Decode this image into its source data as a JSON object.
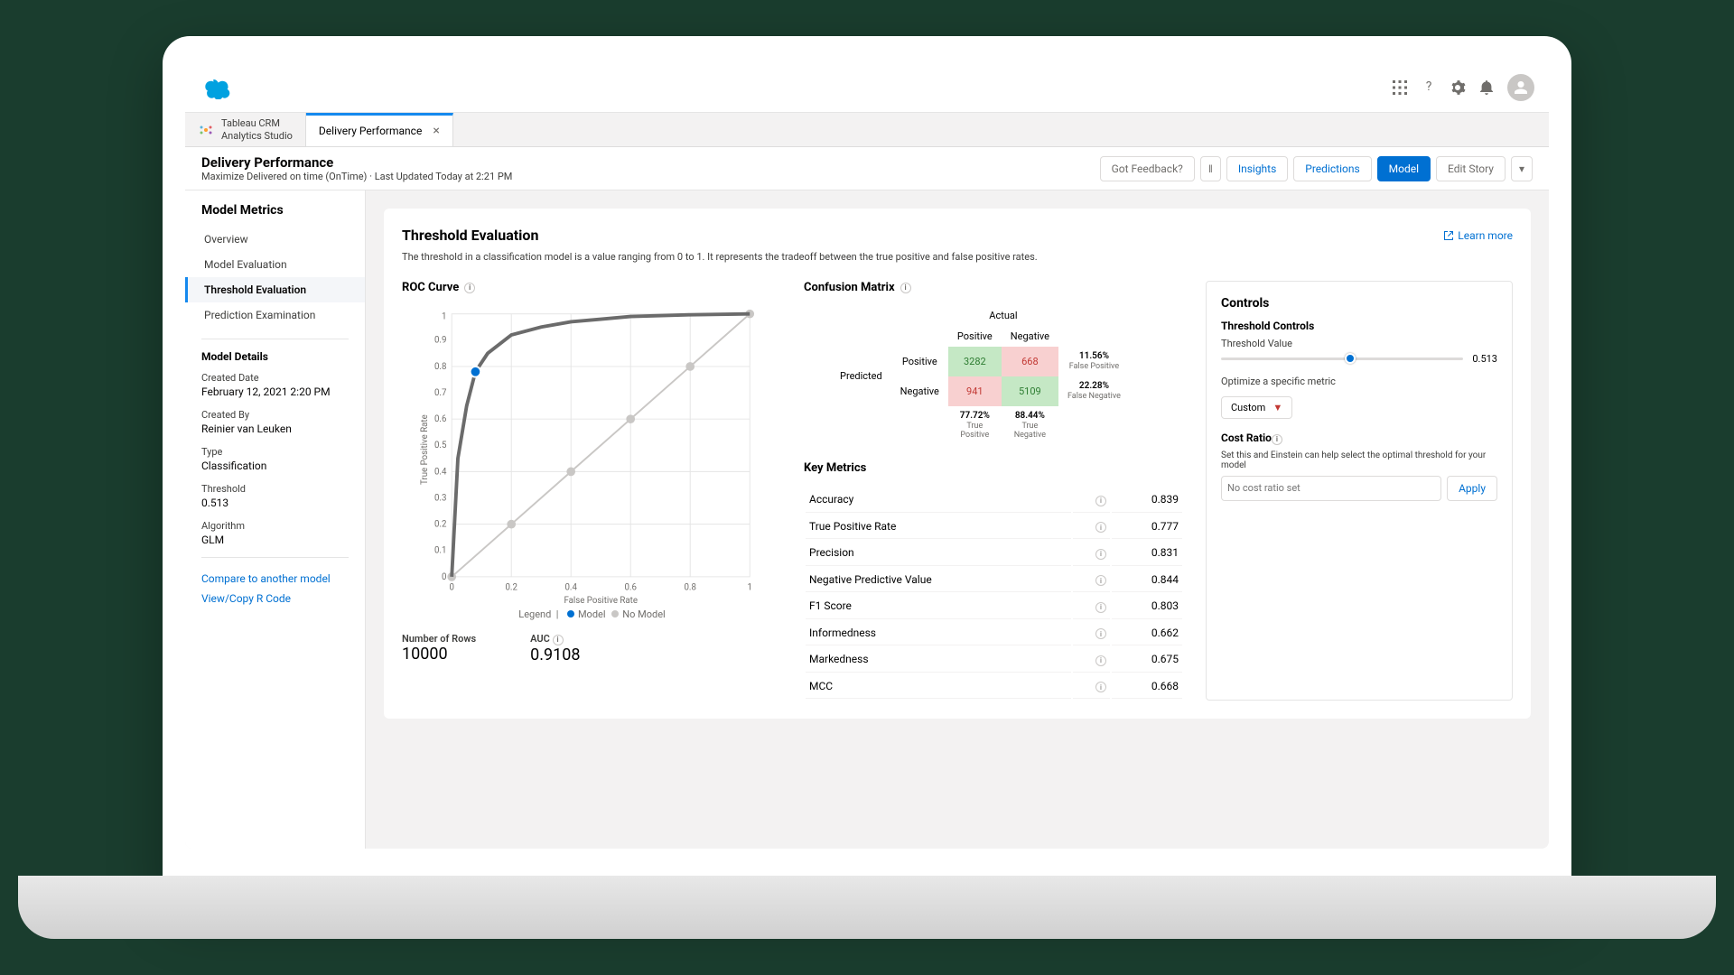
{
  "topbar": {
    "app_waffle": "app-launcher",
    "help": "?",
    "app_product": "Tableau CRM",
    "app_subproduct": "Analytics Studio",
    "page_tab": "Delivery Performance"
  },
  "header": {
    "title": "Delivery Performance",
    "subtitle": "Maximize Delivered on time (OnTime) · Last Updated Today at 2:21 PM",
    "actions": {
      "feedback": "Got Feedback?",
      "insights": "Insights",
      "predictions": "Predictions",
      "model": "Model",
      "edit_story": "Edit Story"
    }
  },
  "sidebar": {
    "title": "Model Metrics",
    "items": [
      {
        "label": "Overview"
      },
      {
        "label": "Model Evaluation"
      },
      {
        "label": "Threshold Evaluation"
      },
      {
        "label": "Prediction Examination"
      }
    ],
    "details_title": "Model Details",
    "meta": {
      "created_date_lbl": "Created Date",
      "created_date": "February 12, 2021 2:20 PM",
      "created_by_lbl": "Created By",
      "created_by": "Reinier van Leuken",
      "type_lbl": "Type",
      "type": "Classification",
      "threshold_lbl": "Threshold",
      "threshold": "0.513",
      "algorithm_lbl": "Algorithm",
      "algorithm": "GLM"
    },
    "links": {
      "compare": "Compare to another model",
      "rcode": "View/Copy R Code"
    }
  },
  "main": {
    "title": "Threshold Evaluation",
    "learn_more": "Learn more",
    "desc": "The threshold in a classification model is a value ranging from 0 to 1. It represents the tradeoff between the true positive and false positive rates."
  },
  "roc": {
    "title": "ROC Curve",
    "ylabel": "True Positive Rate",
    "xlabel": "False Positive Rate",
    "legend_label": "Legend",
    "legend_model": "Model",
    "legend_nomodel": "No Model",
    "rows_lbl": "Number of Rows",
    "rows": "10000",
    "auc_lbl": "AUC",
    "auc": "0.9108"
  },
  "confusion": {
    "title": "Confusion Matrix",
    "actual": "Actual",
    "predicted": "Predicted",
    "positive": "Positive",
    "negative": "Negative",
    "tp": "3282",
    "fp": "668",
    "fn": "941",
    "tn": "5109",
    "fp_rate": "11.56%",
    "fp_sub": "False Positive",
    "fn_rate": "22.28%",
    "fn_sub": "False Negative",
    "tp_rate": "77.72%",
    "tp_sub": "True Positive",
    "tn_rate": "88.44%",
    "tn_sub": "True Negative"
  },
  "metrics": {
    "title": "Key Metrics",
    "rows": [
      {
        "name": "Accuracy",
        "value": "0.839"
      },
      {
        "name": "True Positive Rate",
        "value": "0.777"
      },
      {
        "name": "Precision",
        "value": "0.831"
      },
      {
        "name": "Negative Predictive Value",
        "value": "0.844"
      },
      {
        "name": "F1 Score",
        "value": "0.803"
      },
      {
        "name": "Informedness",
        "value": "0.662"
      },
      {
        "name": "Markedness",
        "value": "0.675"
      },
      {
        "name": "MCC",
        "value": "0.668"
      }
    ]
  },
  "controls": {
    "title": "Controls",
    "threshold_controls": "Threshold Controls",
    "threshold_value_lbl": "Threshold Value",
    "threshold_value": "0.513",
    "optimize_lbl": "Optimize a specific metric",
    "optimize_value": "Custom",
    "cost_ratio_lbl": "Cost Ratio",
    "cost_ratio_help": "Set this and Einstein can help select the optimal threshold for your model",
    "cost_placeholder": "No cost ratio set",
    "apply": "Apply"
  },
  "chart_data": {
    "type": "line",
    "title": "ROC Curve",
    "xlabel": "False Positive Rate",
    "ylabel": "True Positive Rate",
    "xlim": [
      0,
      1
    ],
    "ylim": [
      0,
      1
    ],
    "series": [
      {
        "name": "Model",
        "x": [
          0,
          0.02,
          0.05,
          0.08,
          0.12,
          0.2,
          0.3,
          0.4,
          0.5,
          0.6,
          0.7,
          0.8,
          0.9,
          1.0
        ],
        "y": [
          0,
          0.45,
          0.65,
          0.78,
          0.85,
          0.92,
          0.95,
          0.97,
          0.98,
          0.99,
          0.995,
          0.998,
          0.999,
          1.0
        ]
      },
      {
        "name": "No Model",
        "x": [
          0,
          0.2,
          0.4,
          0.6,
          0.8,
          1.0
        ],
        "y": [
          0,
          0.2,
          0.4,
          0.6,
          0.8,
          1.0
        ]
      }
    ],
    "threshold_point": {
      "fpr": 0.08,
      "tpr": 0.78
    },
    "auc": 0.9108,
    "n_rows": 10000
  }
}
